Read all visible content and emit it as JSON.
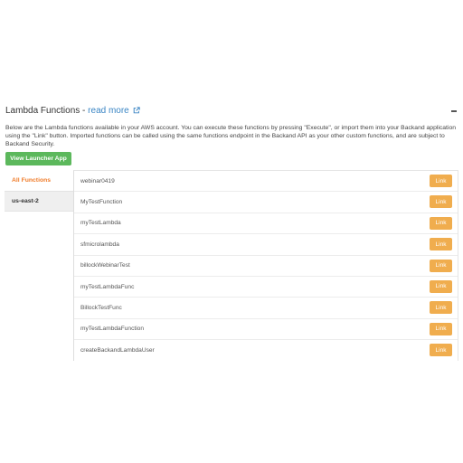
{
  "panel": {
    "title": "Lambda Functions",
    "separator": " - ",
    "read_more": "read more",
    "description": "Below are the Lambda functions available in your AWS account. You can execute these functions by pressing \"Execute\", or import them into your Backand application using the \"Link\" button. Imported functions can be called using the same functions endpoint in the Backand API as your other custom functions, and are subject to Backand Security.",
    "launcher_button": "View Launcher App",
    "accent_colors": {
      "link": "#3a85c4",
      "launcher": "#5cb85c",
      "link_button": "#f0ad4e",
      "active_region": "#f07c2a"
    }
  },
  "regions": [
    {
      "label": "All Functions",
      "active": true
    },
    {
      "label": "us-east-2",
      "active": false
    }
  ],
  "functions": [
    {
      "name": "webinar0419",
      "action": "Link"
    },
    {
      "name": "MyTestFunction",
      "action": "Link"
    },
    {
      "name": "myTestLambda",
      "action": "Link"
    },
    {
      "name": "sfmicrolambda",
      "action": "Link"
    },
    {
      "name": "billockWebinarTest",
      "action": "Link"
    },
    {
      "name": "myTestLambdaFunc",
      "action": "Link"
    },
    {
      "name": "BillockTestFunc",
      "action": "Link"
    },
    {
      "name": "myTestLambdaFunction",
      "action": "Link"
    },
    {
      "name": "createBackandLambdaUser",
      "action": "Link"
    }
  ]
}
